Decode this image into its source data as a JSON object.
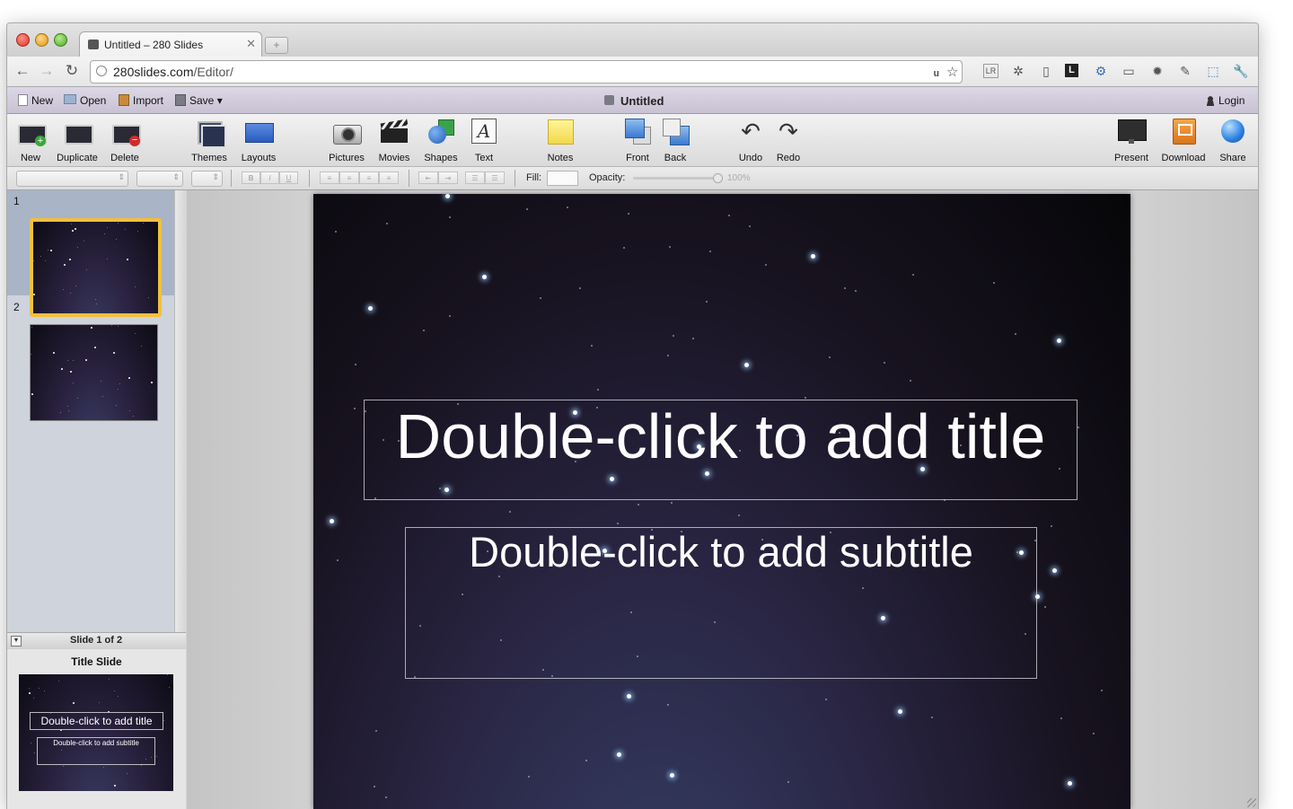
{
  "browser": {
    "tab_title": "Untitled – 280 Slides",
    "tab_close": "✕",
    "new_tab": "+",
    "back": "←",
    "forward": "→",
    "reload": "↻",
    "url_host": "280slides.com",
    "url_path": "/Editor/"
  },
  "menubar": {
    "new": "New",
    "open": "Open",
    "import": "Import",
    "save": "Save",
    "save_arrow": "▾",
    "document_title": "Untitled",
    "login": "Login"
  },
  "toolbar": {
    "new": "New",
    "duplicate": "Duplicate",
    "delete": "Delete",
    "themes": "Themes",
    "layouts": "Layouts",
    "pictures": "Pictures",
    "movies": "Movies",
    "shapes": "Shapes",
    "text": "Text",
    "notes": "Notes",
    "front": "Front",
    "back": "Back",
    "undo": "Undo",
    "redo": "Redo",
    "present": "Present",
    "download": "Download",
    "share": "Share"
  },
  "format": {
    "bold": "B",
    "italic": "I",
    "underline": "U",
    "fill_label": "Fill:",
    "opacity_label": "Opacity:",
    "opacity_value": "100%",
    "opacity_fraction": 1.0
  },
  "slides": {
    "items": [
      {
        "number": "1",
        "selected": true
      },
      {
        "number": "2",
        "selected": false
      }
    ],
    "status": "Slide 1 of 2"
  },
  "layout_panel": {
    "name": "Title Slide",
    "preview_title": "Double-click to add title",
    "preview_subtitle": "Double-click to add subtitle"
  },
  "slide": {
    "title_placeholder": "Double-click to add title",
    "subtitle_placeholder": "Double-click to add subtitle"
  },
  "colors": {
    "selection_accent": "#f1c03c",
    "menubar": "#cfc9dc"
  }
}
